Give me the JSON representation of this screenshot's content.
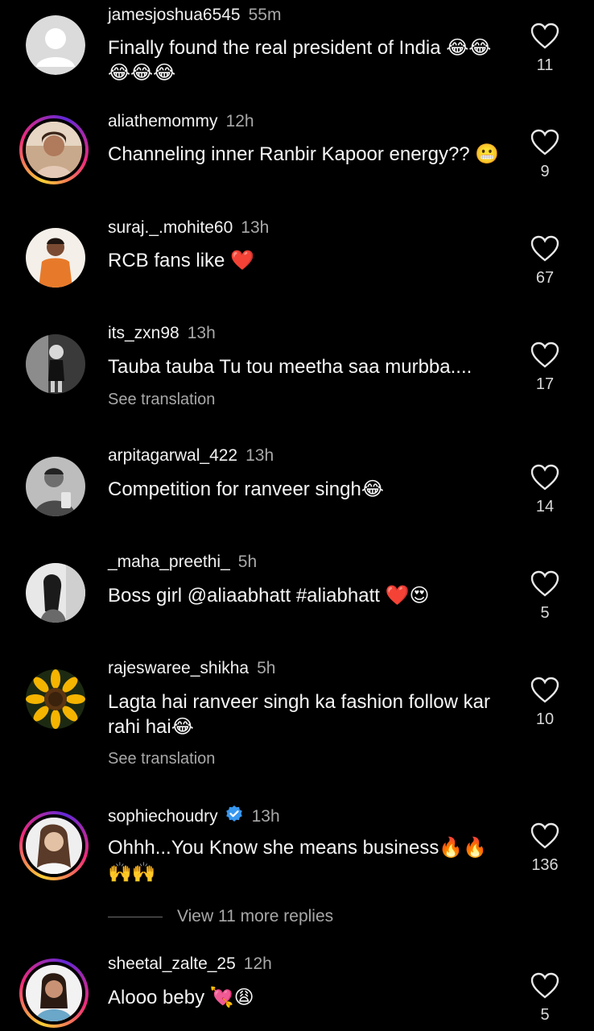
{
  "comments": [
    {
      "username": "jamesjoshua6545",
      "time": "55m",
      "text": "Finally found the real president of India 😂😂😂😂😂",
      "likes": "11",
      "avatar": "default-avatar"
    },
    {
      "username": "aliathemommy",
      "time": "12h",
      "text": "Channeling inner Ranbir Kapoor energy?? 😬",
      "likes": "9",
      "avatar": "story-ring-avatar"
    },
    {
      "username": "suraj._.mohite60",
      "time": "13h",
      "text": "RCB fans like ❤️",
      "likes": "67",
      "avatar": "photo-avatar"
    },
    {
      "username": "its_zxn98",
      "time": "13h",
      "text": "Tauba tauba Tu tou meetha saa murbba....",
      "translation": "See translation",
      "likes": "17",
      "avatar": "photo-avatar"
    },
    {
      "username": "arpitagarwal_422",
      "time": "13h",
      "text": "Competition for ranveer singh😂",
      "likes": "14",
      "avatar": "photo-avatar"
    },
    {
      "username": "_maha_preethi_",
      "time": "5h",
      "text": "Boss girl @aliaabhatt #aliabhatt ❤️😍",
      "likes": "5",
      "avatar": "photo-avatar"
    },
    {
      "username": "rajeswaree_shikha",
      "time": "5h",
      "text": "Lagta hai ranveer singh ka fashion follow kar rahi hai😂",
      "translation": "See translation",
      "likes": "10",
      "avatar": "sunflower-avatar"
    },
    {
      "username": "sophiechoudry",
      "time": "13h",
      "verified": true,
      "text": "Ohhh...You Know she means business🔥🔥🙌🙌",
      "likes": "136",
      "avatar": "story-ring-avatar"
    },
    {
      "username": "sheetal_zalte_25",
      "time": "12h",
      "text": "Alooo beby 💘😩",
      "likes": "5",
      "avatar": "story-ring-avatar"
    }
  ],
  "view_replies": "View 11 more replies",
  "colors": {
    "background": "#000000",
    "secondary_text": "#a8a8a8",
    "verified": "#3897f0"
  }
}
